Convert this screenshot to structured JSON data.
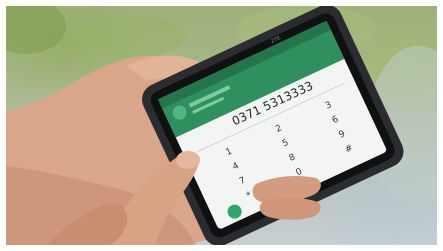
{
  "image": {
    "subject": "Hands holding a smartphone with a dialer screen open",
    "phone": {
      "brand_mark": "ZTE",
      "dialed_number": "0371 5313333",
      "keypad_digits": [
        "1",
        "2",
        "3",
        "4",
        "5",
        "6",
        "7",
        "8",
        "9",
        "*",
        "0",
        "#"
      ],
      "screen_colors": {
        "header": "#2f8f5f",
        "keypad": "#f3f5f4",
        "accent": "#2fa76a"
      }
    },
    "icons": [
      "phone-icon",
      "dial-button-icon"
    ]
  }
}
